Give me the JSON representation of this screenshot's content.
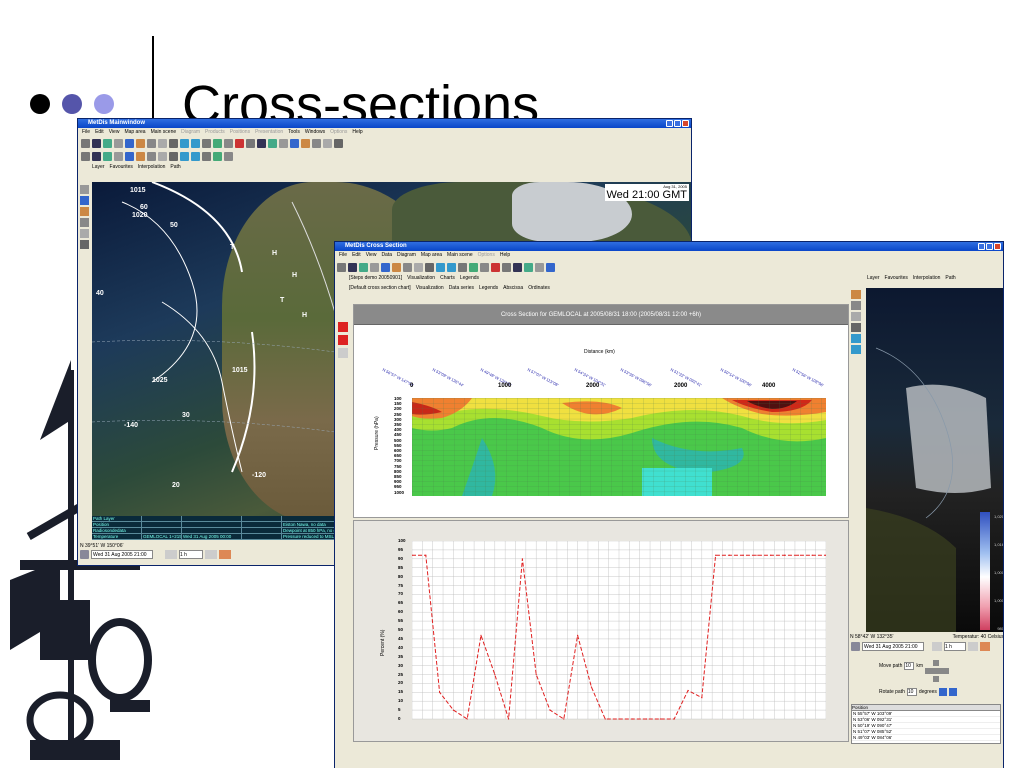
{
  "slide": {
    "title": "Cross-sections"
  },
  "main_window": {
    "title": "MetDis Mainwindow",
    "menu": [
      "File",
      "Edit",
      "View",
      "Map area",
      "Main scene",
      "Diagram",
      "Products",
      "Positions",
      "Presentation",
      "Tools",
      "Windows",
      "Options",
      "Help"
    ],
    "menu_disabled": [
      false,
      false,
      false,
      false,
      false,
      true,
      true,
      true,
      true,
      false,
      false,
      true,
      false
    ],
    "layer_bar": [
      "Layer",
      "Favourites",
      "Interpolation",
      "Path"
    ],
    "time_date": "Aug 31, 2005",
    "time_main": "Wed 21:00 GMT",
    "map_labels": [
      {
        "text": "1015"
      },
      {
        "text": "1020"
      },
      {
        "text": "60"
      },
      {
        "text": "50"
      },
      {
        "text": "40"
      },
      {
        "text": "1025"
      },
      {
        "text": "1015"
      },
      {
        "text": "-140"
      },
      {
        "text": "30"
      },
      {
        "text": "20"
      },
      {
        "text": "-120"
      },
      {
        "text": "T"
      },
      {
        "text": "H"
      },
      {
        "text": "H"
      },
      {
        "text": "H"
      },
      {
        "text": "T"
      },
      {
        "text": "H"
      }
    ],
    "info_table": [
      [
        "Path Layer",
        "",
        "",
        "",
        "",
        "Wed 31 Aug"
      ],
      [
        "Position",
        "",
        "",
        "",
        "Eiston Nawa, no data",
        "Wed 31 Aug"
      ],
      [
        "Radiosondedata",
        "",
        "",
        "",
        "Dewpoint at 850 hPa, no data",
        "Wed 31 Aug"
      ],
      [
        "Temperature",
        "GEMLOCAL 1+2150",
        "Wed 31 Aug 2005 00:00",
        "",
        "Pressure reduced to MSL, hPa, - (mean sea level)",
        "Wed 31 Aug"
      ]
    ],
    "coord": "N 39°51' W 150°06'",
    "time_field": "Wed 31 Aug 2005 21:00",
    "step": "1 h"
  },
  "cross_window": {
    "title": "MetDis Cross Section",
    "menu": [
      "File",
      "Edit",
      "View",
      "Data",
      "Diagram",
      "Map area",
      "Main scene",
      "Options",
      "Help"
    ],
    "menu_disabled": [
      false,
      false,
      false,
      false,
      false,
      false,
      false,
      true,
      false
    ],
    "tabs1": [
      "[Steps demo 20050901]",
      "Visualization",
      "Charts",
      "Legends"
    ],
    "tabs2": [
      "[Default cross section chart]",
      "Visualization",
      "Data series",
      "Legends",
      "Abscissa",
      "Ordinates"
    ],
    "right_layer_bar": [
      "Layer",
      "Favourites",
      "Interpolation",
      "Path"
    ],
    "chart_title": "Cross Section for GEMLOCAL at 2005/08/31 18:00 (2005/08/31 12:00 +6h)",
    "distance_label": "Distance (km)",
    "dist_ticks": [
      "0",
      "1000",
      "2000",
      "2000",
      "4000"
    ],
    "pressure_label": "Pressure (hPa)",
    "pressure_ticks": [
      "100",
      "150",
      "200",
      "250",
      "300",
      "350",
      "400",
      "450",
      "500",
      "550",
      "600",
      "650",
      "700",
      "750",
      "800",
      "850",
      "900",
      "950",
      "1000"
    ],
    "pos_labels": [
      "N 56°57' W 147°06'",
      "N 53°09' W 136°44'",
      "N 49°48' W 126°11'",
      "N 57°07' W 113°08'",
      "N 54°24' W 104°31'",
      "N 53°35' W 096°56'",
      "N 51°22' W 093°41'",
      "N 50°14' W 100°06'",
      "N 52°56' W 108°06'"
    ],
    "percent_label": "Percent (%)",
    "percent_ticks": [
      "100",
      "95",
      "90",
      "85",
      "80",
      "75",
      "70",
      "65",
      "60",
      "55",
      "50",
      "45",
      "40",
      "35",
      "30",
      "25",
      "20",
      "15",
      "10",
      "5",
      "0"
    ],
    "right_coord": "N 58°42' W 132°35'",
    "right_temp": "Temperatur: 40 Celsius",
    "right_time": "Wed 31 Aug 2005 21:00",
    "right_step": "1 h",
    "move_path_label": "Move path",
    "move_path_value": "10",
    "move_unit": "km",
    "rotate_label": "Rotate path",
    "rotate_value": "10",
    "rotate_unit": "degrees",
    "legend_ticks": [
      "1,020",
      "1,016",
      "1,000",
      "1,000",
      "980"
    ],
    "pos_list_header": "Position",
    "pos_list": [
      "N 55°57' W 103°09'",
      "N 53°06' W 092°31'",
      "N 50°19' W 090°47'",
      "N 51°07' W 085°52'",
      "N 49°03' W 084°06'"
    ]
  },
  "chart_data": {
    "type": "line",
    "title": "",
    "xlabel": "",
    "ylabel": "Percent (%)",
    "ylim": [
      0,
      100
    ],
    "series": [
      {
        "values": [
          92,
          92,
          15,
          5,
          0,
          47,
          25,
          0,
          90,
          25,
          5,
          0,
          47,
          18,
          0,
          0,
          0,
          0,
          0,
          0,
          16,
          12,
          92,
          92,
          92,
          92,
          92,
          92,
          92,
          92,
          92
        ]
      }
    ],
    "style": "dashed-red",
    "grid": true
  }
}
